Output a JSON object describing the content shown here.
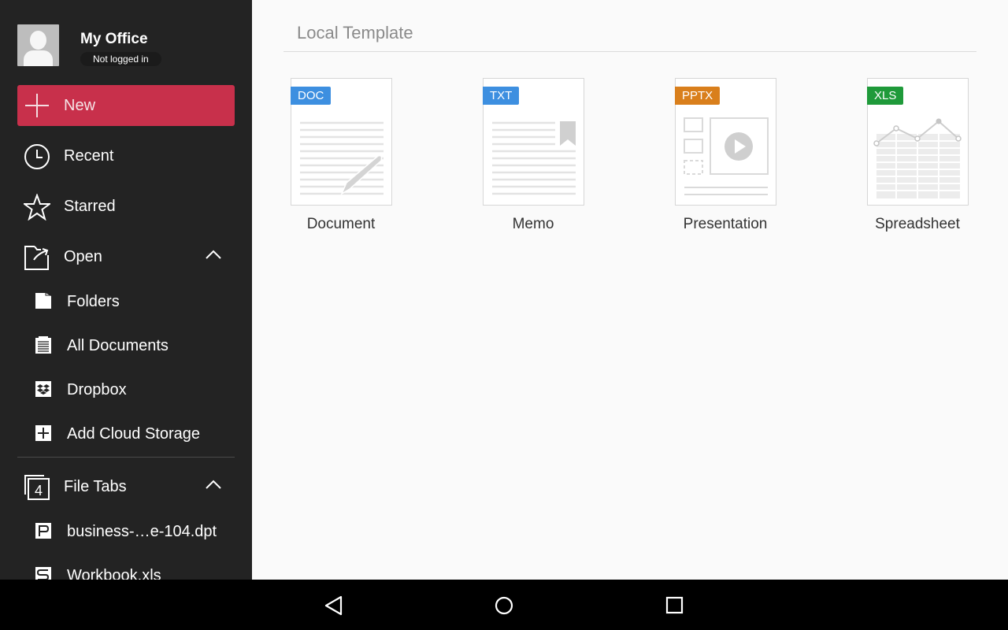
{
  "sidebar": {
    "profile": {
      "name": "My Office",
      "status": "Not logged in"
    },
    "new_label": "New",
    "items": [
      {
        "label": "Recent",
        "icon": "clock-icon"
      },
      {
        "label": "Starred",
        "icon": "star-icon"
      },
      {
        "label": "Open",
        "icon": "open-folder-icon",
        "expanded": true
      }
    ],
    "open_sub_items": [
      {
        "label": "Folders",
        "icon": "folder-icon"
      },
      {
        "label": "All Documents",
        "icon": "documents-icon"
      },
      {
        "label": "Dropbox",
        "icon": "dropbox-icon"
      },
      {
        "label": "Add Cloud Storage",
        "icon": "add-cloud-icon"
      }
    ],
    "file_tabs": {
      "label": "File Tabs",
      "count": "4",
      "expanded": true,
      "files": [
        {
          "label": "business-…e-104.dpt",
          "icon": "presentation-file-icon"
        },
        {
          "label": "Workbook.xls",
          "icon": "sheet-file-icon"
        }
      ]
    }
  },
  "main": {
    "section_title": "Local Template",
    "templates": [
      {
        "name": "Document",
        "badge": "DOC",
        "badge_color": "#3d8fe0"
      },
      {
        "name": "Memo",
        "badge": "TXT",
        "badge_color": "#3d8fe0"
      },
      {
        "name": "Presentation",
        "badge": "PPTX",
        "badge_color": "#d97f1c"
      },
      {
        "name": "Spreadsheet",
        "badge": "XLS",
        "badge_color": "#1f9a3a"
      }
    ]
  },
  "colors": {
    "sidebar_bg": "#232323",
    "accent_new": "#c8304b",
    "content_bg": "#fafafa"
  },
  "system_nav": [
    "back",
    "home",
    "recents"
  ]
}
